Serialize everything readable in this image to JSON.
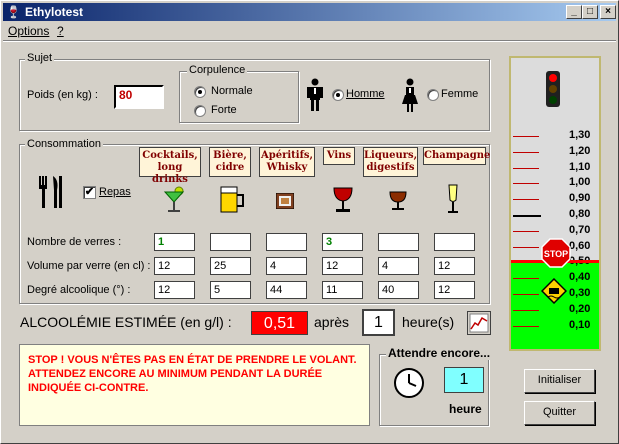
{
  "window": {
    "title": "Ethylotest",
    "minimize": "_",
    "maximize": "□",
    "close": "×"
  },
  "menu": {
    "options": "Options",
    "help": "?"
  },
  "sujet": {
    "label": "Sujet",
    "poids_label": "Poids (en kg) :",
    "poids_value": "80",
    "corpulence_label": "Corpulence",
    "normale": "Normale",
    "forte": "Forte",
    "corpulence_selected": "Normale",
    "homme": "Homme",
    "femme": "Femme",
    "sexe_selected": "Homme"
  },
  "consommation": {
    "label": "Consommation",
    "repas_label": "Repas",
    "repas_checked": true,
    "row_labels": [
      "Nombre de verres :",
      "Volume par verre (en cl) :",
      "Degré alcoolique  (°) :"
    ],
    "drinks": [
      {
        "name": "Cocktails, long drinks",
        "icon": "cocktail-icon",
        "verres": "1",
        "volume": "12",
        "degre": "12"
      },
      {
        "name": "Bière, cidre",
        "icon": "beer-mug-icon",
        "verres": "",
        "volume": "25",
        "degre": "5"
      },
      {
        "name": "Apéritifs, Whisky",
        "icon": "aperitif-icon",
        "verres": "",
        "volume": "4",
        "degre": "44"
      },
      {
        "name": "Vins",
        "icon": "wine-glass-icon",
        "verres": "3",
        "volume": "12",
        "degre": "11"
      },
      {
        "name": "Liqueurs, digestifs",
        "icon": "liqueur-glass-icon",
        "verres": "",
        "volume": "4",
        "degre": "40"
      },
      {
        "name": "Champagne",
        "icon": "champagne-flute-icon",
        "verres": "",
        "volume": "12",
        "degre": "12"
      }
    ]
  },
  "result": {
    "label": "ALCOOLÉMIE ESTIMÉE (en g/l) :",
    "value": "0,51",
    "apres": "après",
    "hours": "1",
    "heures": "heure(s)"
  },
  "message": "STOP ! VOUS N'ÊTES PAS EN ÉTAT DE PRENDRE LE VOLANT. ATTENDEZ ENCORE AU MINIMUM PENDANT LA DURÉE INDIQUÉE CI-CONTRE.",
  "attendre": {
    "label": "Attendre encore...",
    "value": "1",
    "unit": "heure"
  },
  "buttons": {
    "initialiser": "Initialiser",
    "quitter": "Quitter"
  },
  "gauge": {
    "labels": [
      "1,30",
      "1,20",
      "1,10",
      "1,00",
      "0,90",
      "0,80",
      "0,70",
      "0,60",
      "0,50",
      "0,40",
      "0,30",
      "0,20",
      "0,10"
    ],
    "stop_text": "STOP",
    "level": 0.51,
    "limit": 0.5,
    "safe_color": "#00ff00",
    "alert_color": "#ff0000"
  }
}
